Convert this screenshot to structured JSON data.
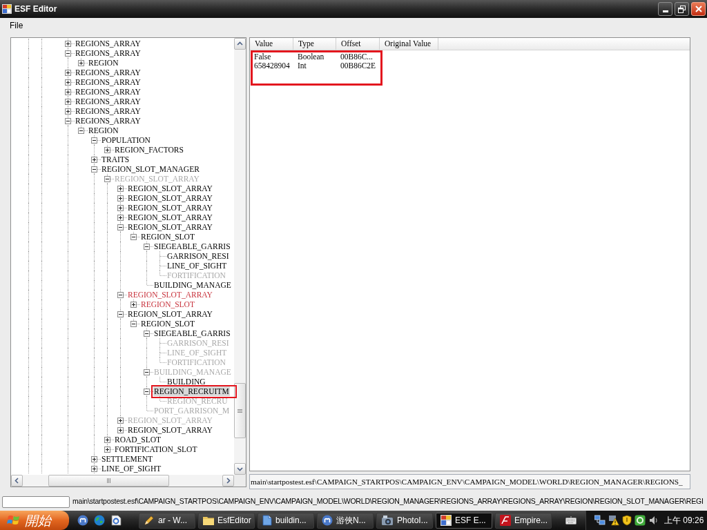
{
  "window": {
    "title": "ESF Editor"
  },
  "menu": [
    {
      "label": "File"
    }
  ],
  "tree": {
    "nodes": [
      {
        "label": "REGIONS_ARRAY",
        "kind": "branch",
        "expanded": false,
        "selected": false,
        "color": "#000000"
      },
      {
        "label": "REGIONS_ARRAY",
        "kind": "branch",
        "expanded": true,
        "selected": false,
        "color": "#000000",
        "children": [
          {
            "label": "REGION",
            "kind": "branch",
            "expanded": false,
            "selected": false,
            "color": "#000000"
          }
        ]
      },
      {
        "label": "REGIONS_ARRAY",
        "kind": "branch",
        "expanded": false,
        "selected": false,
        "color": "#000000"
      },
      {
        "label": "REGIONS_ARRAY",
        "kind": "branch",
        "expanded": false,
        "selected": false,
        "color": "#000000"
      },
      {
        "label": "REGIONS_ARRAY",
        "kind": "branch",
        "expanded": false,
        "selected": false,
        "color": "#000000"
      },
      {
        "label": "REGIONS_ARRAY",
        "kind": "branch",
        "expanded": false,
        "selected": false,
        "color": "#000000"
      },
      {
        "label": "REGIONS_ARRAY",
        "kind": "branch",
        "expanded": false,
        "selected": false,
        "color": "#000000"
      },
      {
        "label": "REGIONS_ARRAY",
        "kind": "branch",
        "expanded": true,
        "selected": false,
        "color": "#000000",
        "continues": true,
        "children": [
          {
            "label": "REGION",
            "kind": "branch",
            "expanded": true,
            "selected": false,
            "color": "#000000",
            "children": [
              {
                "label": "POPULATION",
                "kind": "branch",
                "expanded": true,
                "selected": false,
                "color": "#000000",
                "children": [
                  {
                    "label": "REGION_FACTORS",
                    "kind": "branch",
                    "expanded": false,
                    "selected": false,
                    "color": "#000000"
                  }
                ]
              },
              {
                "label": "TRAITS",
                "kind": "branch",
                "expanded": false,
                "selected": false,
                "color": "#000000"
              },
              {
                "label": "REGION_SLOT_MANAGER",
                "kind": "branch",
                "expanded": true,
                "selected": false,
                "color": "#000000",
                "children": [
                  {
                    "label": "REGION_SLOT_ARRAY",
                    "kind": "branch",
                    "expanded": true,
                    "selected": false,
                    "color": "#a8a8a8",
                    "children": [
                      {
                        "label": "REGION_SLOT_ARRAY",
                        "kind": "branch",
                        "expanded": false,
                        "selected": false,
                        "color": "#000000"
                      },
                      {
                        "label": "REGION_SLOT_ARRAY",
                        "kind": "branch",
                        "expanded": false,
                        "selected": false,
                        "color": "#000000"
                      },
                      {
                        "label": "REGION_SLOT_ARRAY",
                        "kind": "branch",
                        "expanded": false,
                        "selected": false,
                        "color": "#000000"
                      },
                      {
                        "label": "REGION_SLOT_ARRAY",
                        "kind": "branch",
                        "expanded": false,
                        "selected": false,
                        "color": "#000000"
                      },
                      {
                        "label": "REGION_SLOT_ARRAY",
                        "kind": "branch",
                        "expanded": true,
                        "selected": false,
                        "color": "#000000",
                        "children": [
                          {
                            "label": "REGION_SLOT",
                            "kind": "branch",
                            "expanded": true,
                            "selected": false,
                            "color": "#000000",
                            "children": [
                              {
                                "label": "SIEGEABLE_GARRIS",
                                "kind": "branch",
                                "expanded": true,
                                "selected": false,
                                "color": "#000000",
                                "children": [
                                  {
                                    "label": "GARRISON_RESI",
                                    "kind": "leaf",
                                    "selected": false,
                                    "color": "#000000"
                                  },
                                  {
                                    "label": "LINE_OF_SIGHT",
                                    "kind": "leaf",
                                    "selected": false,
                                    "color": "#000000"
                                  },
                                  {
                                    "label": "FORTIFICATION",
                                    "kind": "leaf",
                                    "selected": false,
                                    "color": "#a8a8a8"
                                  }
                                ]
                              },
                              {
                                "label": "BUILDING_MANAGE",
                                "kind": "leaf",
                                "selected": false,
                                "color": "#000000"
                              }
                            ]
                          }
                        ]
                      },
                      {
                        "label": "REGION_SLOT_ARRAY",
                        "kind": "branch",
                        "expanded": true,
                        "selected": false,
                        "color": "#c8323c",
                        "children": [
                          {
                            "label": "REGION_SLOT",
                            "kind": "branch",
                            "expanded": false,
                            "selected": false,
                            "color": "#c8323c"
                          }
                        ]
                      },
                      {
                        "label": "REGION_SLOT_ARRAY",
                        "kind": "branch",
                        "expanded": true,
                        "selected": false,
                        "color": "#000000",
                        "children": [
                          {
                            "label": "REGION_SLOT",
                            "kind": "branch",
                            "expanded": true,
                            "selected": false,
                            "color": "#000000",
                            "children": [
                              {
                                "label": "SIEGEABLE_GARRIS",
                                "kind": "branch",
                                "expanded": true,
                                "selected": false,
                                "color": "#000000",
                                "children": [
                                  {
                                    "label": "GARRISON_RESI",
                                    "kind": "leaf",
                                    "selected": false,
                                    "color": "#a8a8a8"
                                  },
                                  {
                                    "label": "LINE_OF_SIGHT",
                                    "kind": "leaf",
                                    "selected": false,
                                    "color": "#a8a8a8"
                                  },
                                  {
                                    "label": "FORTIFICATION",
                                    "kind": "leaf",
                                    "selected": false,
                                    "color": "#a8a8a8"
                                  }
                                ]
                              },
                              {
                                "label": "BUILDING_MANAGE",
                                "kind": "branch",
                                "expanded": true,
                                "selected": false,
                                "color": "#a8a8a8",
                                "children": [
                                  {
                                    "label": "BUILDING",
                                    "kind": "leaf",
                                    "selected": false,
                                    "color": "#000000"
                                  }
                                ]
                              },
                              {
                                "label": "REGION_RECRUITM",
                                "kind": "branch",
                                "expanded": true,
                                "selected": true,
                                "annotated": true,
                                "color": "#000000",
                                "children": [
                                  {
                                    "label": "REGION_RECRU",
                                    "kind": "leaf",
                                    "selected": false,
                                    "color": "#a8a8a8"
                                  }
                                ]
                              },
                              {
                                "label": "PORT_GARRISON_M",
                                "kind": "leaf",
                                "selected": false,
                                "color": "#a8a8a8"
                              }
                            ]
                          }
                        ]
                      },
                      {
                        "label": "REGION_SLOT_ARRAY",
                        "kind": "branch",
                        "expanded": false,
                        "selected": false,
                        "color": "#a8a8a8"
                      },
                      {
                        "label": "REGION_SLOT_ARRAY",
                        "kind": "branch",
                        "expanded": false,
                        "selected": false,
                        "color": "#000000"
                      }
                    ]
                  },
                  {
                    "label": "ROAD_SLOT",
                    "kind": "branch",
                    "expanded": false,
                    "selected": false,
                    "color": "#000000"
                  },
                  {
                    "label": "FORTIFICATION_SLOT",
                    "kind": "branch",
                    "expanded": false,
                    "selected": false,
                    "color": "#000000"
                  }
                ]
              },
              {
                "label": "SETTLEMENT",
                "kind": "branch",
                "expanded": false,
                "selected": false,
                "color": "#000000"
              },
              {
                "label": "LINE_OF_SIGHT",
                "kind": "branch",
                "expanded": false,
                "selected": false,
                "color": "#000000",
                "continues": true
              }
            ]
          }
        ]
      }
    ]
  },
  "list_view": {
    "columns": [
      "Value",
      "Type",
      "Offset",
      "Original Value"
    ],
    "rows": [
      [
        "False",
        "Boolean",
        "00B86C..."
      ],
      [
        "658428904",
        "Int",
        "00B86C2E"
      ]
    ],
    "annotated": true
  },
  "path_field": {
    "value": "main\\startpostest.esf\\CAMPAIGN_STARTPOS\\CAMPAIGN_ENV\\CAMPAIGN_MODEL\\WORLD\\REGION_MANAGER\\REGIONS_"
  },
  "status_bar": {
    "text": "main\\startpostest.esf\\CAMPAIGN_STARTPOS\\CAMPAIGN_ENV\\CAMPAIGN_MODEL\\WORLD\\REGION_MANAGER\\REGIONS_ARRAY\\REGIONS_ARRAY\\REGION\\REGION_SLOT_MANAGER\\REGI"
  },
  "taskbar": {
    "start": "開始",
    "tasks": [
      {
        "label": "ar - W...",
        "selected": false
      },
      {
        "label": "EsfEditor",
        "selected": false
      },
      {
        "label": "buildin...",
        "selected": false
      },
      {
        "label": "游俠N...",
        "selected": false
      },
      {
        "label": "PhotoI...",
        "selected": false
      },
      {
        "label": "ESF E...",
        "selected": true
      },
      {
        "label": "Empire...",
        "selected": false
      }
    ],
    "clock": "上午 09:26"
  }
}
